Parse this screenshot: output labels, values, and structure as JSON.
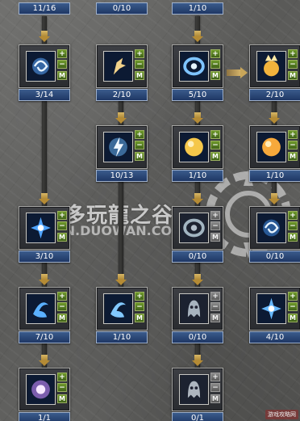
{
  "top_levels": [
    "11/16",
    "0/10",
    "1/10"
  ],
  "buttons": {
    "plus": "+",
    "minus": "−",
    "master": "M"
  },
  "watermark": {
    "text": "多玩龍之谷",
    "url": "ON.DUOWAN.CO",
    "stamp": "游戏攻略网"
  },
  "skills": [
    {
      "id": "r1c1",
      "level": "3/14",
      "icon": "swirl-orb-icon",
      "color": "#5aa8ff",
      "active": true
    },
    {
      "id": "r1c2",
      "level": "2/10",
      "icon": "kick-strike-icon",
      "color": "#f2d28a",
      "active": true
    },
    {
      "id": "r1c3",
      "level": "5/10",
      "icon": "ring-shield-icon",
      "color": "#7fc4ff",
      "active": true
    },
    {
      "id": "r1c4",
      "level": "2/10",
      "icon": "golden-fist-icon",
      "color": "#f2b33c",
      "active": true
    },
    {
      "id": "r2c2",
      "level": "10/13",
      "icon": "lightning-bolt-icon",
      "color": "#6ab9ff",
      "active": true
    },
    {
      "id": "r2c3",
      "level": "1/10",
      "icon": "golden-orb-icon",
      "color": "#f5c74a",
      "active": true
    },
    {
      "id": "r2c4",
      "level": "1/10",
      "icon": "fire-orb-icon",
      "color": "#f7a93b",
      "active": true
    },
    {
      "id": "r3c1",
      "level": "3/10",
      "icon": "spark-burst-icon",
      "color": "#4fa4ff",
      "active": true
    },
    {
      "id": "r3c3",
      "level": "0/10",
      "icon": "frost-ring-icon",
      "color": "#cfe6f2",
      "active": false
    },
    {
      "id": "r3c4",
      "level": "0/10",
      "icon": "blue-vortex-icon",
      "color": "#3f8ee8",
      "active": true
    },
    {
      "id": "r4c1",
      "level": "7/10",
      "icon": "wind-cyclone-icon",
      "color": "#5ab0ff",
      "active": true
    },
    {
      "id": "r4c2",
      "level": "1/10",
      "icon": "wave-slash-icon",
      "color": "#82c8ff",
      "active": true
    },
    {
      "id": "r4c3",
      "level": "0/10",
      "icon": "ghost-spirit-icon",
      "color": "#d6e4ee",
      "active": false
    },
    {
      "id": "r4c4",
      "level": "4/10",
      "icon": "star-burst-icon",
      "color": "#66b8ff",
      "active": true
    },
    {
      "id": "r5c1",
      "level": "1/1",
      "icon": "violet-aura-icon",
      "color": "#c68bff",
      "active": true
    },
    {
      "id": "r5c3",
      "level": "0/1",
      "icon": "pale-spirit-icon",
      "color": "#dfe8ef",
      "active": false
    }
  ]
}
